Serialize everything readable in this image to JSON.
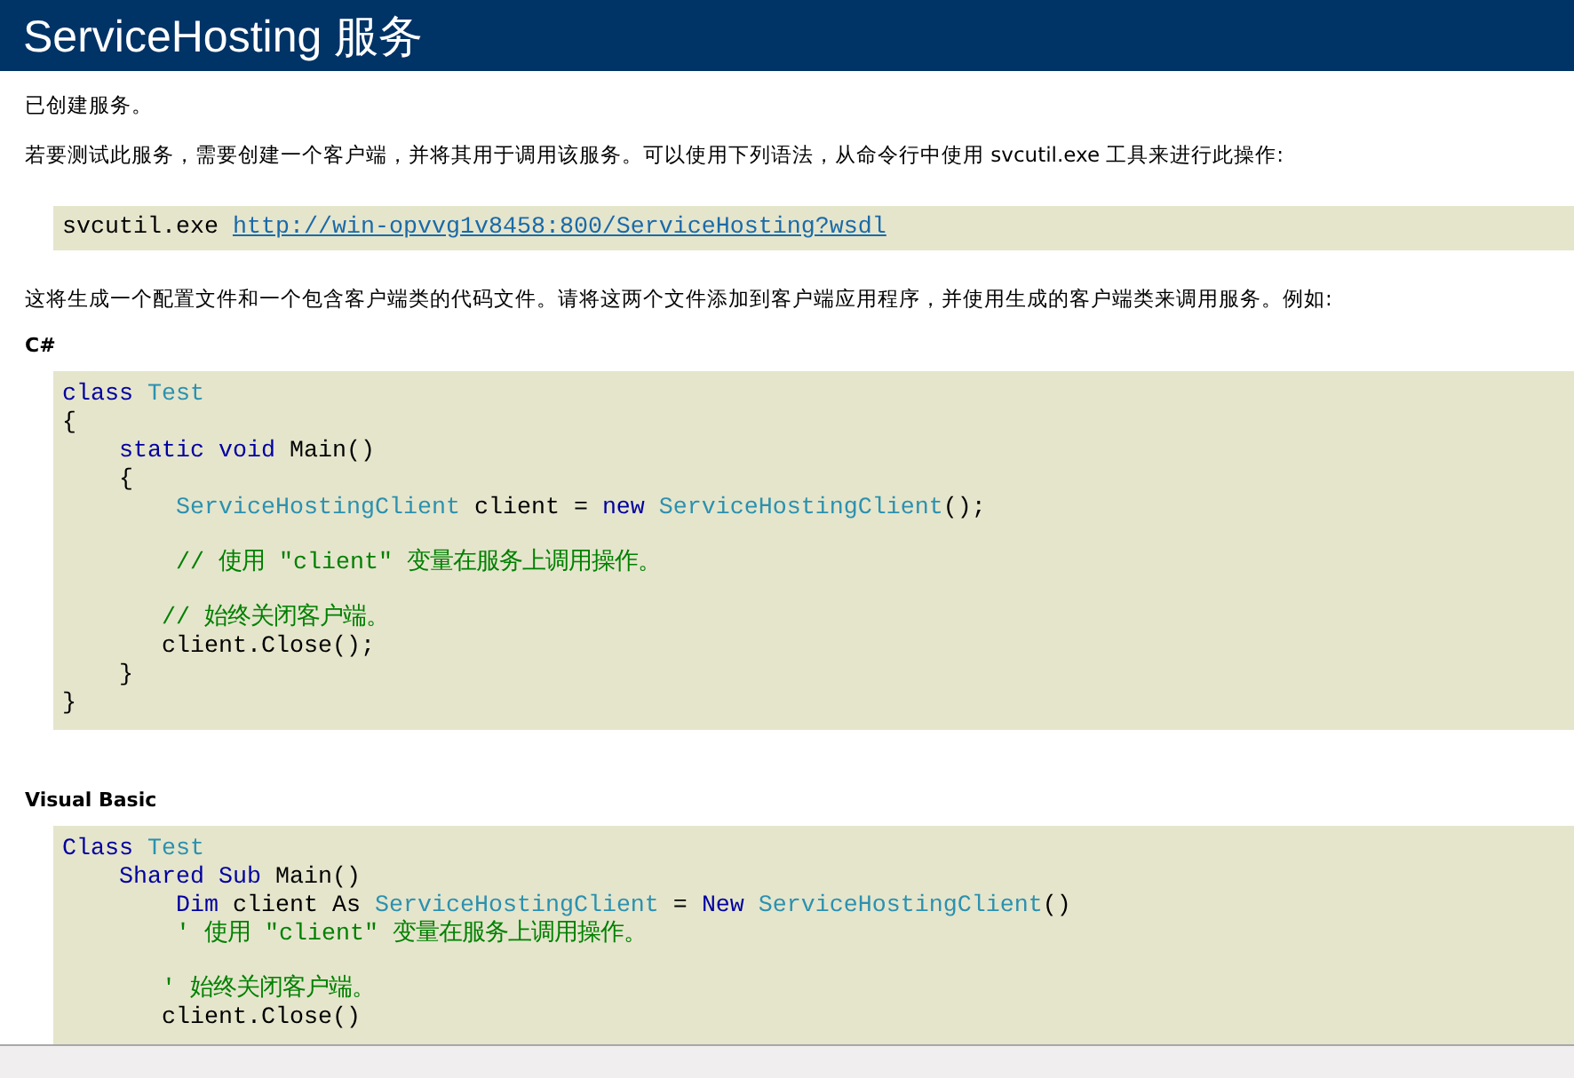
{
  "header": {
    "title": "ServiceHosting 服务"
  },
  "sections": [
    {
      "kind": "paragraph",
      "text": "已创建服务。"
    },
    {
      "kind": "paragraph",
      "text": "若要测试此服务，需要创建一个客户端，并将其用于调用该服务。可以使用下列语法，从命令行中使用 svcutil.exe 工具来进行此操作:"
    },
    {
      "kind": "command",
      "text": "svcutil.exe ",
      "link": "http://win-opvvg1v8458:800/ServiceHosting?wsdl"
    },
    {
      "kind": "paragraph",
      "text": "这将生成一个配置文件和一个包含客户端类的代码文件。请将这两个文件添加到客户端应用程序，并使用生成的客户端类来调用服务。例如:"
    },
    {
      "kind": "heading",
      "text": "C#"
    },
    {
      "kind": "code",
      "lines": [
        {
          "kind": "code",
          "tokens": [
            {
              "kind": "kw",
              "text": "class"
            },
            {
              "kind": "type",
              "text": " Test"
            }
          ]
        },
        {
          "kind": "code",
          "tokens": [
            {
              "kind": "plain",
              "text": "{"
            }
          ]
        },
        {
          "kind": "code",
          "tokens": [
            {
              "kind": "kw",
              "text": "    static"
            },
            {
              "kind": "kw",
              "text": " void"
            },
            {
              "kind": "plain",
              "text": " Main()"
            }
          ]
        },
        {
          "kind": "code",
          "tokens": [
            {
              "kind": "plain",
              "text": "    {"
            }
          ]
        },
        {
          "kind": "code",
          "tokens": [
            {
              "kind": "type",
              "text": "        ServiceHostingClient"
            },
            {
              "kind": "plain",
              "text": " client = "
            },
            {
              "kind": "kw",
              "text": "new"
            },
            {
              "kind": "type",
              "text": " ServiceHostingClient"
            },
            {
              "kind": "plain",
              "text": "();"
            }
          ]
        },
        {
          "kind": "blank"
        },
        {
          "kind": "code",
          "tokens": [
            {
              "kind": "comment",
              "text": "        // 使用 \"client\" 变量在服务上调用操作。"
            }
          ]
        },
        {
          "kind": "blank"
        },
        {
          "kind": "code",
          "tokens": [
            {
              "kind": "comment",
              "text": "       // 始终关闭客户端。"
            }
          ]
        },
        {
          "kind": "code",
          "tokens": [
            {
              "kind": "plain",
              "text": "       client.Close();"
            }
          ]
        },
        {
          "kind": "code",
          "tokens": [
            {
              "kind": "plain",
              "text": "    }"
            }
          ]
        },
        {
          "kind": "code",
          "tokens": [
            {
              "kind": "plain",
              "text": "}"
            }
          ]
        }
      ]
    },
    {
      "kind": "heading",
      "text": "Visual Basic"
    },
    {
      "kind": "code",
      "lines": [
        {
          "kind": "code",
          "tokens": [
            {
              "kind": "kw",
              "text": "Class"
            },
            {
              "kind": "type",
              "text": " Test"
            }
          ]
        },
        {
          "kind": "code",
          "tokens": [
            {
              "kind": "kw",
              "text": "    Shared"
            },
            {
              "kind": "kw",
              "text": " Sub"
            },
            {
              "kind": "plain",
              "text": " Main()"
            }
          ]
        },
        {
          "kind": "code",
          "tokens": [
            {
              "kind": "kw",
              "text": "        Dim"
            },
            {
              "kind": "plain",
              "text": " client As "
            },
            {
              "kind": "type",
              "text": "ServiceHostingClient"
            },
            {
              "kind": "plain",
              "text": " = "
            },
            {
              "kind": "kw",
              "text": "New"
            },
            {
              "kind": "type",
              "text": " ServiceHostingClient"
            },
            {
              "kind": "plain",
              "text": "()"
            }
          ]
        },
        {
          "kind": "code",
          "tokens": [
            {
              "kind": "comment",
              "text": "        ' 使用 \"client\" 变量在服务上调用操作。"
            }
          ]
        },
        {
          "kind": "blank"
        },
        {
          "kind": "code",
          "tokens": [
            {
              "kind": "comment",
              "text": "       ' 始终关闭客户端。"
            }
          ]
        },
        {
          "kind": "code",
          "tokens": [
            {
              "kind": "plain",
              "text": "       client.Close()"
            }
          ]
        }
      ]
    }
  ]
}
